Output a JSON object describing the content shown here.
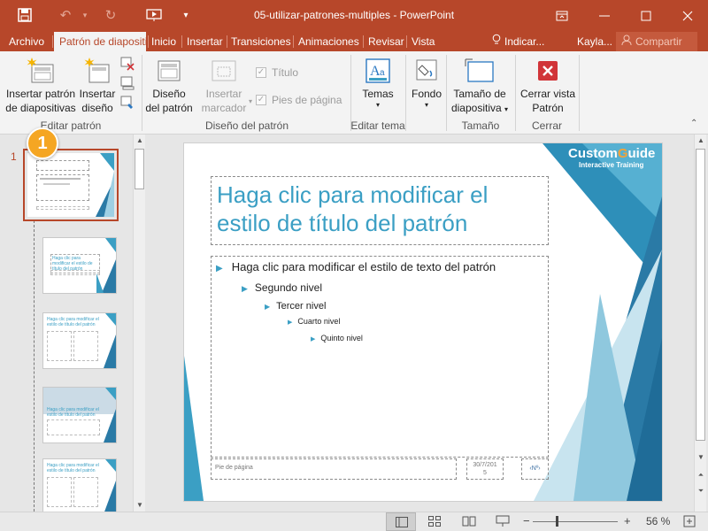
{
  "window": {
    "title": "05-utilizar-patrones-multiples - PowerPoint"
  },
  "tabs": {
    "file": "Archivo",
    "master": "Patrón de diapositiva",
    "home": "Inicio",
    "insert": "Insertar",
    "transitions": "Transiciones",
    "animations": "Animaciones",
    "review": "Revisar",
    "view": "Vista",
    "tell": "Indicar...",
    "user": "Kayla...",
    "share": "Compartir"
  },
  "ribbon": {
    "insert_master_l1": "Insertar patrón",
    "insert_master_l2": "de diapositivas",
    "insert_layout_l1": "Insertar",
    "insert_layout_l2": "diseño",
    "group_edit_master": "Editar patrón",
    "master_layout_l1": "Diseño",
    "master_layout_l2": "del patrón",
    "insert_placeholder_l1": "Insertar",
    "insert_placeholder_l2": "marcador",
    "title_chk": "Título",
    "footers_chk": "Pies de página",
    "group_master_layout": "Diseño del patrón",
    "themes": "Temas",
    "group_edit_theme": "Editar tema",
    "background": "Fondo",
    "slide_size_l1": "Tamaño de",
    "slide_size_l2": "diapositiva",
    "group_size": "Tamaño",
    "close_l1": "Cerrar vista",
    "close_l2": "Patrón",
    "group_close": "Cerrar"
  },
  "callout": "1",
  "thumbnails": {
    "number": "1",
    "t2_title": "Haga clic para modificar el estilo de título del patrón",
    "t3_title": "Haga clic para modificar el estilo de título del patrón",
    "t4_title": "Haga clic para modificar el estilo de título del patrón",
    "t5_title": "Haga clic para modificar el estilo de título del patrón"
  },
  "slide": {
    "logo_a": "Custom",
    "logo_b": "G",
    "logo_c": "uide",
    "logo_sub": "Interactive Training",
    "title": "Haga clic para modificar el estilo de título del patrón",
    "l1": "Haga clic para modificar el estilo de texto del patrón",
    "l2": "Segundo nivel",
    "l3": "Tercer nivel",
    "l4": "Cuarto nivel",
    "l5": "Quinto nivel",
    "footer": "Pie de página",
    "date_l1": "30/7/201",
    "date_l2": "5",
    "page": "‹Nº›"
  },
  "status": {
    "zoom_minus": "−",
    "zoom_plus": "+",
    "zoom": "56 %"
  },
  "colors": {
    "accent": "#b7472a",
    "slide_accent": "#3b9fc4",
    "logo_orange": "#f2a33a"
  }
}
